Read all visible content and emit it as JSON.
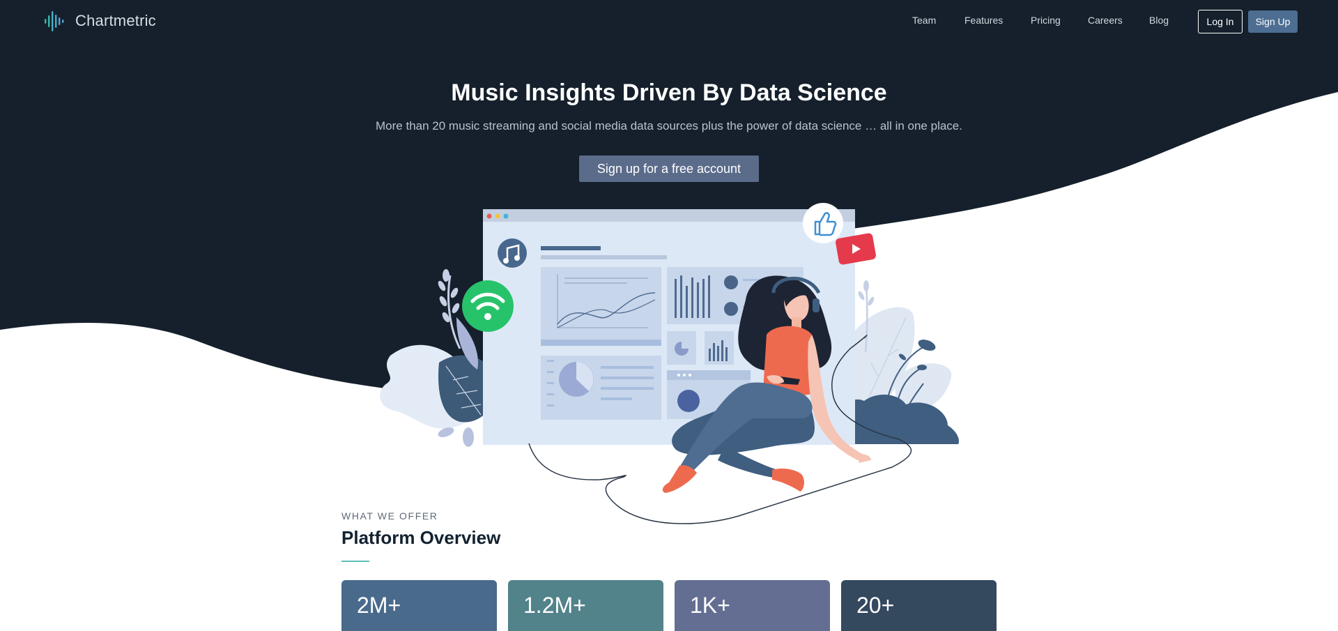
{
  "brand": {
    "name": "Chartmetric"
  },
  "nav": {
    "links": [
      {
        "label": "Team"
      },
      {
        "label": "Features"
      },
      {
        "label": "Pricing"
      },
      {
        "label": "Careers"
      },
      {
        "label": "Blog"
      }
    ],
    "login_label": "Log In",
    "signup_label": "Sign Up"
  },
  "hero": {
    "title": "Music Insights Driven By Data Science",
    "subtitle": "More than 20 music streaming and social media data sources plus the power of data science … all in one place.",
    "cta_label": "Sign up for a free account"
  },
  "illustration_icons": [
    "music-note-icon",
    "wifi-icon",
    "thumbs-up-icon",
    "play-icon"
  ],
  "overview": {
    "eyebrow": "WHAT WE OFFER",
    "title": "Platform Overview",
    "stats": [
      {
        "value": "2M+",
        "color": "#4a6a8c"
      },
      {
        "value": "1.2M+",
        "color": "#52828a"
      },
      {
        "value": "1K+",
        "color": "#636e92"
      },
      {
        "value": "20+",
        "color": "#34495e"
      }
    ]
  },
  "colors": {
    "navy": "#15202c",
    "accent": "#4d6e92",
    "teal": "#5bbfb8"
  }
}
